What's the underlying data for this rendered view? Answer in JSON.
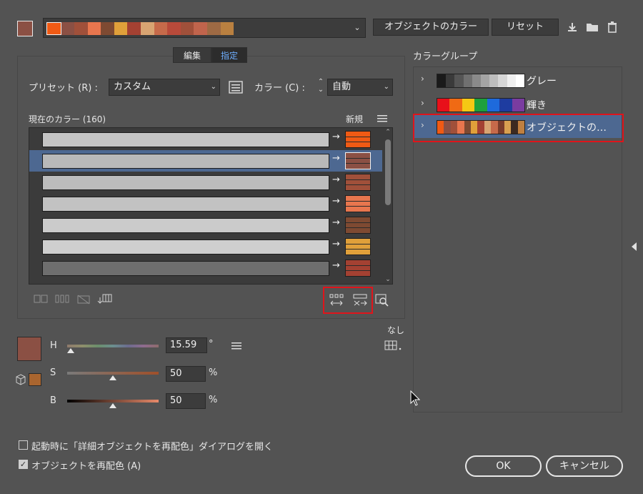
{
  "top": {
    "current_swatch_color": "#8b5044",
    "harmony_colors": [
      "#f05a14",
      "#8b5044",
      "#a0503a",
      "#e8764e",
      "#7e4a32",
      "#e0a03a",
      "#a44132",
      "#d8a472",
      "#c66a4a",
      "#b84a3a",
      "#a0503a",
      "#c0644c",
      "#9e6a44",
      "#b98040"
    ],
    "object_color_label": "オブジェクトのカラー",
    "reset_label": "リセット"
  },
  "tabs": {
    "edit": "編集",
    "assign": "指定"
  },
  "preset": {
    "label": "プリセット (R) :",
    "value": "カスタム"
  },
  "colors": {
    "label": "カラー (C) :",
    "value": "自動"
  },
  "list": {
    "header_current": "現在のカラー (160)",
    "header_new": "新規",
    "rows": [
      {
        "current": "#c4c4c4",
        "new": [
          "#f05a14",
          "#f05a14",
          "#f05a14"
        ],
        "selected": false
      },
      {
        "current": "#b9b9b9",
        "new": [
          "#8b5044",
          "#8b5044",
          "#8b5044"
        ],
        "selected": true
      },
      {
        "current": "#bcbcbc",
        "new": [
          "#a0503a",
          "#a0503a",
          "#a0503a"
        ],
        "selected": false
      },
      {
        "current": "#c2c2c2",
        "new": [
          "#e8764e",
          "#e8764e",
          "#e8764e"
        ],
        "selected": false
      },
      {
        "current": "#cbcbcb",
        "new": [
          "#7e4a32",
          "#7e4a32",
          "#7e4a32"
        ],
        "selected": false
      },
      {
        "current": "#cfcfcf",
        "new": [
          "#e0a03a",
          "#e0a03a",
          "#e0a03a"
        ],
        "selected": false
      },
      {
        "current": "#6e6e6e",
        "new": [
          "#a44132",
          "#a44132",
          "#a44132"
        ],
        "selected": false
      }
    ]
  },
  "color_groups": {
    "title": "カラーグループ",
    "groups": [
      {
        "name": "グレー",
        "colors": [
          "#1a1a1a",
          "#3a3a3a",
          "#555555",
          "#707070",
          "#8a8a8a",
          "#a4a4a4",
          "#bdbdbd",
          "#d6d6d6",
          "#efefef",
          "#ffffff"
        ],
        "selected": false
      },
      {
        "name": "輝き",
        "colors": [
          "#e8101a",
          "#f06a14",
          "#f5c814",
          "#1ea03c",
          "#1e6adc",
          "#1e3ca0",
          "#7a3ca0"
        ],
        "selected": false
      },
      {
        "name": "オブジェクトの…",
        "colors": [
          "#f05a14",
          "#8b5044",
          "#a0503a",
          "#e8764e",
          "#7e4a32",
          "#e0a03a",
          "#a44132",
          "#d8a472",
          "#c66a4a",
          "#7a3c2a",
          "#d8a050",
          "#3c2a20",
          "#c08040"
        ],
        "selected": true
      }
    ]
  },
  "hsb": {
    "h": {
      "label": "H",
      "value": "15.59",
      "unit": "°",
      "level": 0.04
    },
    "s": {
      "label": "S",
      "value": "50",
      "unit": "%",
      "level": 0.5
    },
    "b": {
      "label": "B",
      "value": "50",
      "unit": "%",
      "level": 0.5
    },
    "big_swatch_color": "#8b5044",
    "mini_swatch_color": "#a9652f"
  },
  "none_label": "なし",
  "footer": {
    "open_on_launch": "起動時に「詳細オブジェクトを再配色」ダイアログを開く",
    "recolor_object": "オブジェクトを再配色 (A)",
    "ok": "OK",
    "cancel": "キャンセル"
  }
}
